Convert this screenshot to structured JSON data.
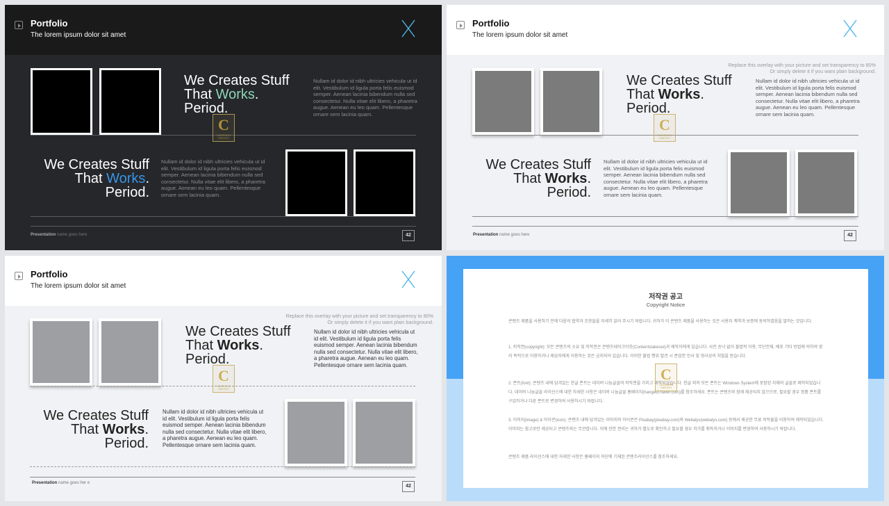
{
  "slides": [
    {
      "theme": "dark",
      "header": {
        "title": "Portfolio",
        "subtitle": "The lorem ipsum dolor sit amet"
      },
      "block_top": {
        "line1": "We Creates Stuff",
        "line2_a": "That ",
        "line2_b": "Works",
        "line2_c": ".",
        "line3": "Period."
      },
      "block_bottom": {
        "line1": "We Creates Stuff",
        "line2_a": "That ",
        "line2_b": "Works",
        "line2_c": ".",
        "line3": "Period."
      },
      "para_top": "Nullam id dolor id nibh ultricies vehicula ut id elit. Vestibulum id ligula porta felis euismod semper. Aenean lacinia bibendum nulla sed consectetur. Nulla vitae elit libero, a pharetra augue. Aenean eu leo quam. Pellentesque ornare sem lacinia quam.",
      "para_bottom": "Nullam id dolor id nibh ultricies vehicula ut id elit. Vestibulum id ligula porta felis euismod semper. Aenean lacinia bibendum nulla sed consectetur. Nulla vitae elit libero, a pharetra augue. Aenean eu leo quam. Pellentesque ornare sem lacinia quam.",
      "footer": {
        "bold": "Presentation",
        "rest": " name goes here"
      },
      "page": "42"
    },
    {
      "theme": "light",
      "header": {
        "title": "Portfolio",
        "subtitle": "The lorem ipsum dolor sit amet"
      },
      "overlay": {
        "line1": "Replace this overlay with your picture and set transparency to 80%",
        "line2": "Or simply delete it if you want plain background."
      },
      "block_top": {
        "line1": "We Creates Stuff",
        "line2_a": "That ",
        "line2_b": "Works",
        "line2_c": ".",
        "line3": "Period."
      },
      "block_bottom": {
        "line1": "We Creates Stuff",
        "line2_a": "That ",
        "line2_b": "Works",
        "line2_c": ".",
        "line3": "Period."
      },
      "para_top": "Nullam id dolor id nibh ultricies vehicula ut id elit. Vestibulum id ligula porta felis euismod semper. Aenean lacinia bibendum nulla sed consectetur. Nulla vitae elit libero, a pharetra augue. Aenean eu leo quam. Pellentesque ornare sem lacinia quam.",
      "para_bottom": "Nullam id dolor id nibh ultricies vehicula ut id elit. Vestibulum id ligula porta felis euismod semper. Aenean lacinia bibendum nulla sed consectetur. Nulla vitae elit libero, a pharetra augue. Aenean eu leo quam. Pellentesque ornare sem lacinia quam.",
      "footer": {
        "bold": "Presentation",
        "rest": " name goes here"
      },
      "page": "42"
    },
    {
      "theme": "light",
      "header": {
        "title": "Portfolio",
        "subtitle": "The lorem ipsum dolor sit amet"
      },
      "overlay": {
        "line1": "Replace this overlay with your picture and set transparency to 80%",
        "line2": "Or simply delete it if you want plain background."
      },
      "block_top": {
        "line1": "We Creates Stuff",
        "line2_a": "That ",
        "line2_b": "Works",
        "line2_c": ".",
        "line3": "Period."
      },
      "block_bottom": {
        "line1": "We Creates Stuff",
        "line2_a": "That ",
        "line2_b": "Works",
        "line2_c": ".",
        "line3": "Period."
      },
      "para_top": "Nullam id dolor id nibh ultricies vehicula ut id elit. Vestibulum id ligula porta felis euismod semper. Aenean lacinia bibendum nulla sed consectetur. Nulla vitae elit libero, a pharetra augue. Aenean eu leo quam. Pellentesque ornare sem lacinia quam.",
      "para_bottom": "Nullam id dolor id nibh ultricies vehicula ut id elit. Vestibulum id ligula porta felis euismod semper. Aenean lacinia bibendum nulla sed consectetur. Nulla vitae elit libero, a pharetra augue. Aenean eu leo quam. Pellentesque ornare sem lacinia quam.",
      "footer": {
        "bold": "Presentation",
        "rest": " name goes her e"
      },
      "page": "42"
    }
  ],
  "logo_text": "CONTENTS TAKEOUT",
  "notice": {
    "title": "저작권 공고",
    "subtitle": "Copyright Notice",
    "p1": "콘텐츠 제품을 사용하기 전에 다음의 협약과 조항들을 자세히 읽어 주시기 바랍니다. 귀하가 이 콘텐츠 제품을 사용하는 것은 사용자 계약과 보증에 동의하였음을 말하는 것입니다.",
    "p2": "1. 저작권(copyright): 모든 콘텐츠의 소유 및 저작권은 콘텐츠테이크아웃(Contentstakeout)과 제작자에게 있습니다. 사전 승낙 없이 불법적 이용, 무단전재, 배포 기타 방법에 의하여 영리 목적으로 이용하거나 제삼자에게 이용하는 것은 금지되어 있습니다. 이러한 불법 행위 발견 시 준엄한 민사 및 형사상의 처벌을 받습니다.",
    "p3": "2. 폰트(font): 콘텐츠 내에 담겨있는 한글 폰트는 네이버 나눔글꼴의 저작권을 가지고 제작되었습니다. 한글 외의 모든 폰트는 Windows System에 포함된 자체의 글꼴로 제작되었습니다. 네이버 나눔글꼴 라이선스에 대한 자세한 사항은 네이버 나눔글꼴 홈페이지(hangeul.naver.com)를 참조하세요. 폰트는 콘텐츠와 함께 제공되지 않으므로, 필요할 경우 정품 폰트를 구입하거나 다른 폰트로 변경하여 사용하시기 바랍니다.",
    "p4": "3. 이미지(image) & 아이콘(icon): 콘텐츠 내에 담겨있는 이미지와 아이콘은 Pixabay(pixabay.com)와 Webalys(webalys.com) 등에서 제공한 무료 저작물을 이용하여 제작되었습니다. 이미지는 참고로만 제공되고 콘텐츠와는 무관합니다. 이에 관한 권리는 귀하가 별도로 확인하고 필요할 경우 허가를 취득하거나 이미지를 변경하여 사용하시기 바랍니다.",
    "p5": "콘텐츠 제품 라이선스에 대한 자세한 사항은 홈페이지 하단에 기재된 콘텐츠라이선스를 참조하세요."
  }
}
